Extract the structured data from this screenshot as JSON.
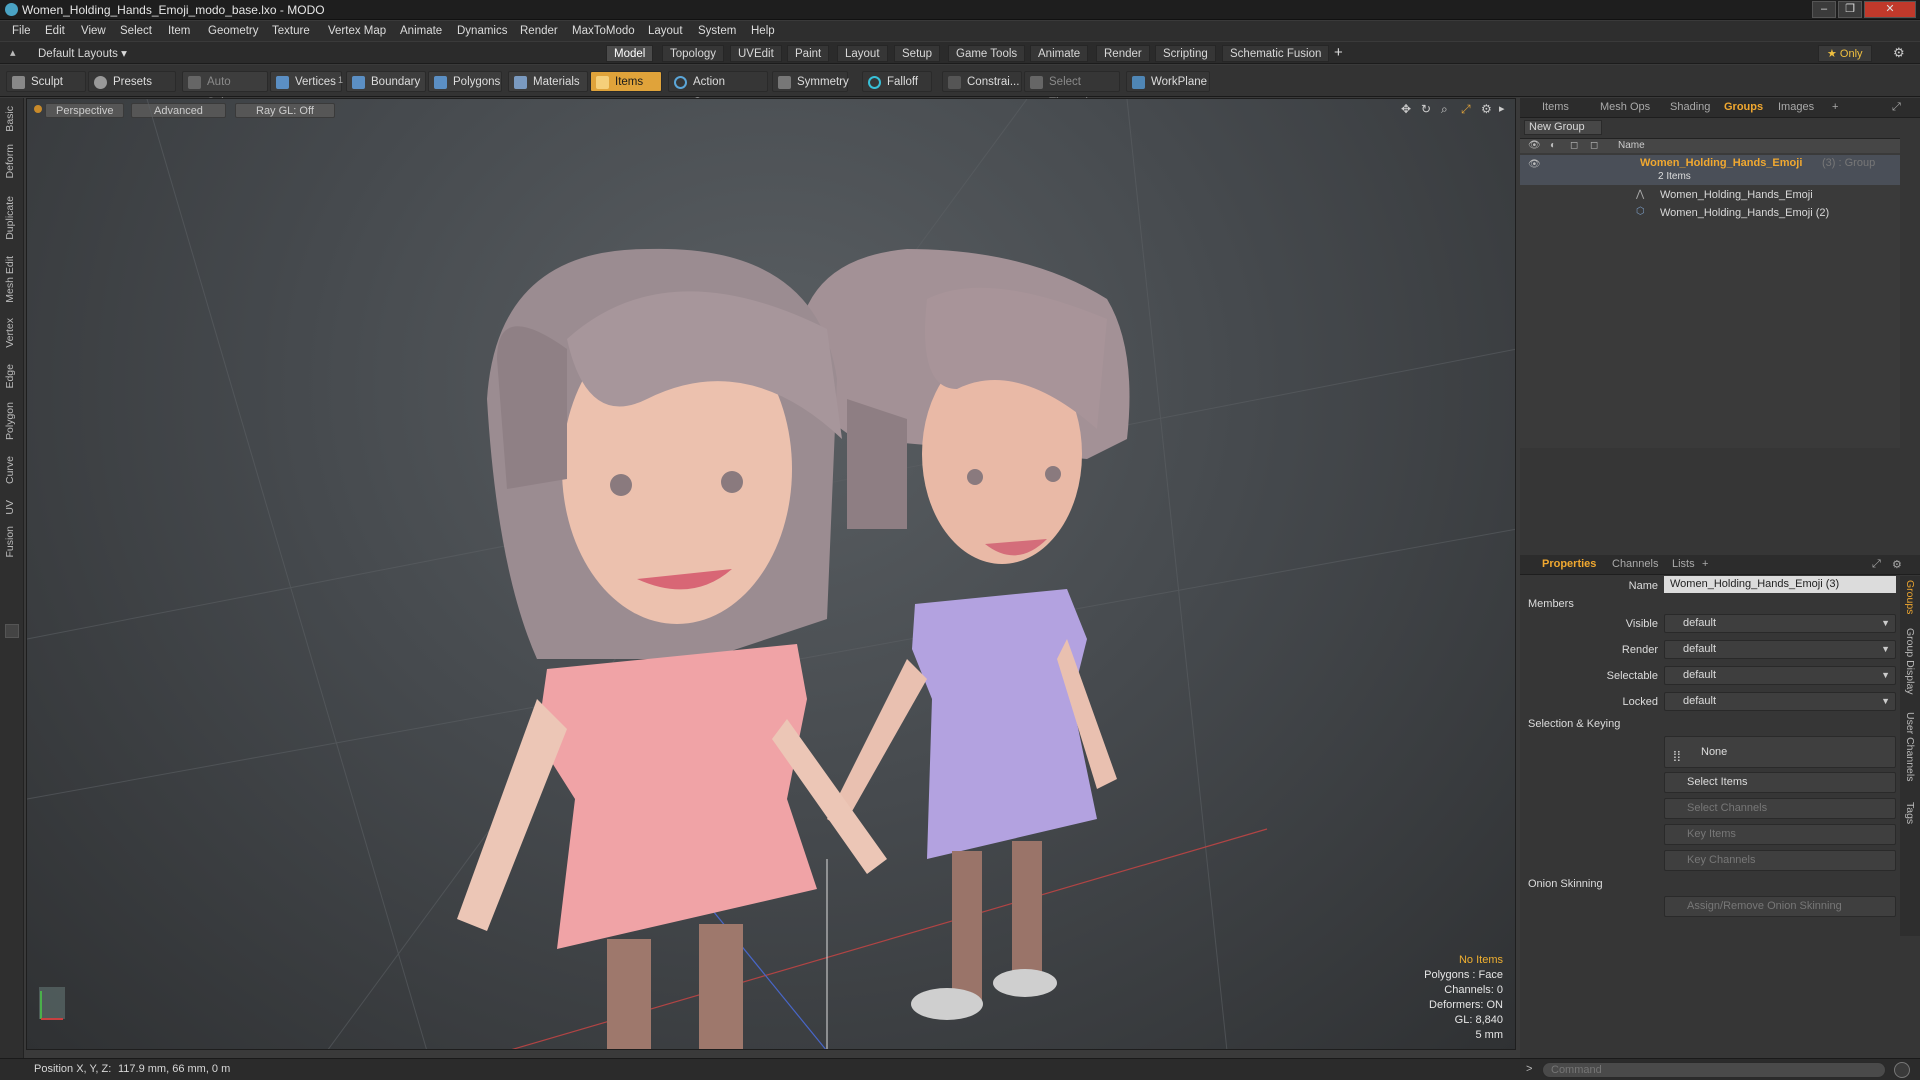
{
  "title": "Women_Holding_Hands_Emoji_modo_base.lxo - MODO",
  "window_buttons": [
    "–",
    "❐",
    "✕"
  ],
  "menu": [
    "File",
    "Edit",
    "View",
    "Select",
    "Item",
    "Geometry",
    "Texture",
    "Vertex Map",
    "Animate",
    "Dynamics",
    "Render",
    "MaxToModo",
    "Layout",
    "System",
    "Help"
  ],
  "layout_dropdown": "Default Layouts ▾",
  "layout_tabs": [
    "Model",
    "Topology",
    "UVEdit",
    "Paint",
    "Layout",
    "Setup",
    "Game Tools",
    "Animate",
    "Render",
    "Scripting",
    "Schematic Fusion"
  ],
  "layout_plus": "+",
  "only_label": "★  Only",
  "toolbar": {
    "sculpt": "Sculpt",
    "presets": "Presets",
    "auto_select": "Auto Select",
    "vertices": "Vertices",
    "vertices_count": "1",
    "boundary": "Boundary",
    "polygons": "Polygons",
    "materials": "Materials",
    "items": "Items",
    "action_center": "Action Center",
    "symmetry": "Symmetry",
    "falloff": "Falloff",
    "constraints": "Constrai...",
    "select_through": "Select Through",
    "workplane": "WorkPlane"
  },
  "left_tabs": [
    "Basic",
    "Deform",
    "Duplicate",
    "Mesh Edit",
    "Vertex",
    "Edge",
    "Polygon",
    "Curve",
    "UV",
    "Fusion"
  ],
  "viewport": {
    "view": "Perspective",
    "mode": "Advanced",
    "raygl": "Ray GL: Off",
    "info": {
      "no_items": "No Items",
      "polygons": "Polygons : Face",
      "channels": "Channels: 0",
      "deformers": "Deformers: ON",
      "gl": "GL: 8,840",
      "scale": "5 mm"
    }
  },
  "top_panel": {
    "tabs": [
      "Items",
      "Mesh Ops",
      "Shading",
      "Groups",
      "Images"
    ],
    "new_group": "New Group",
    "name_col": "Name",
    "group_name": "Women_Holding_Hands_Emoji",
    "group_suffix": "(3) : Group",
    "group_count": "2 Items",
    "children": [
      "Women_Holding_Hands_Emoji",
      "Women_Holding_Hands_Emoji (2)"
    ]
  },
  "props_panel": {
    "tabs": [
      "Properties",
      "Channels",
      "Lists"
    ],
    "name_label": "Name",
    "name_value": "Women_Holding_Hands_Emoji (3)",
    "members": "Members",
    "visible_label": "Visible",
    "visible": "default",
    "render_label": "Render",
    "render": "default",
    "selectable_label": "Selectable",
    "selectable": "default",
    "locked_label": "Locked",
    "locked": "default",
    "sel_keying": "Selection & Keying",
    "none": "None",
    "select_items": "Select Items",
    "select_channels": "Select Channels",
    "key_items": "Key Items",
    "key_channels": "Key Channels",
    "onion": "Onion Skinning",
    "onion_btn": "Assign/Remove Onion Skinning",
    "side_tabs": [
      "Groups",
      "Group Display",
      "User Channels",
      "Tags"
    ]
  },
  "status": {
    "position_label": "Position X, Y, Z:",
    "position_value": "117.9 mm, 66 mm, 0 m",
    "command_placeholder": "Command"
  }
}
